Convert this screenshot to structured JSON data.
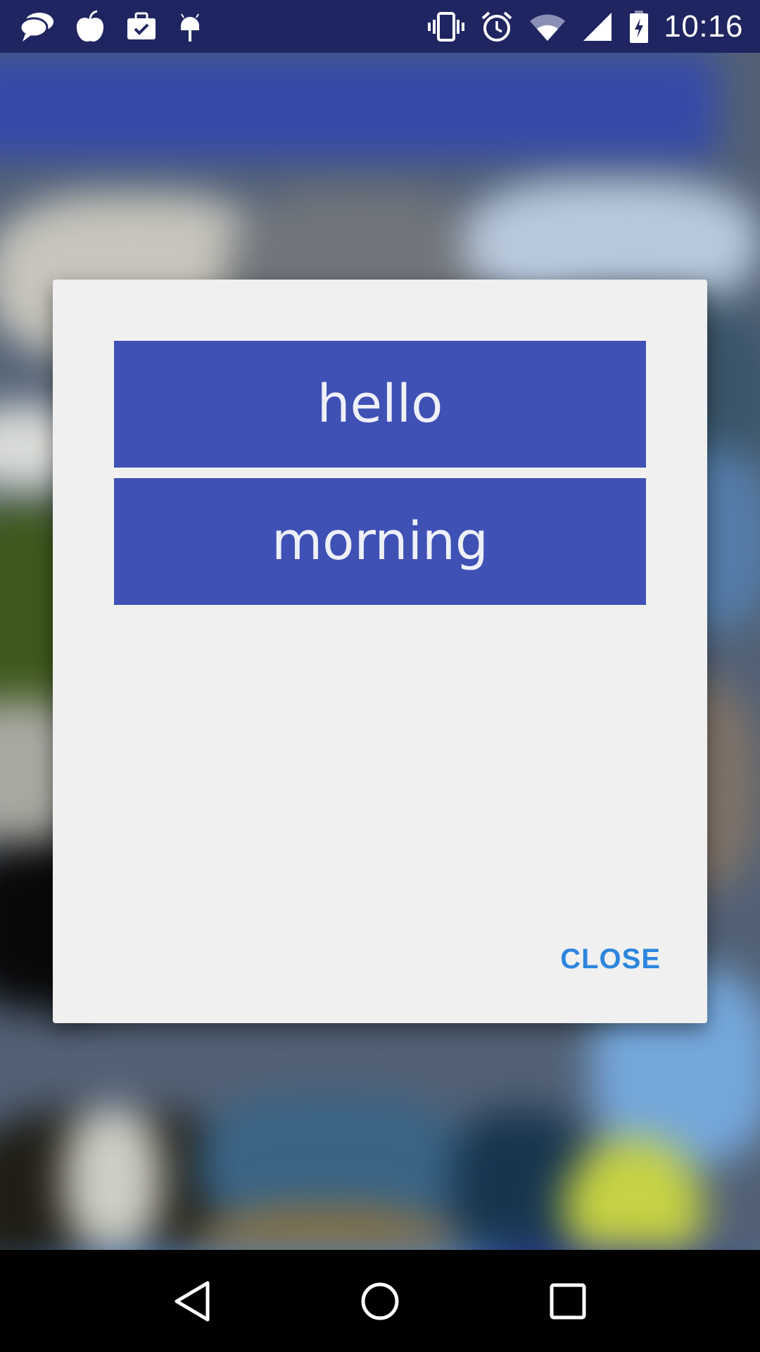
{
  "status_bar": {
    "time": "10:16",
    "left_icons": [
      "chat-bubbles-icon",
      "apple-icon",
      "briefcase-check-icon",
      "android-icon"
    ],
    "right_icons": [
      "vibrate-icon",
      "alarm-icon",
      "wifi-icon",
      "signal-icon",
      "battery-charging-icon"
    ]
  },
  "dialog": {
    "items": [
      {
        "label": "hello"
      },
      {
        "label": "morning"
      }
    ],
    "close_label": "CLOSE"
  },
  "nav_bar": {
    "buttons": [
      "back-icon",
      "home-icon",
      "recents-icon"
    ]
  },
  "colors": {
    "status_bar": "#1e2560",
    "button_bg": "#3f51b5",
    "button_text": "#eef0f8",
    "dialog_bg": "#f0f0f0",
    "close_text": "#2d86de",
    "nav_bar": "#000000"
  }
}
